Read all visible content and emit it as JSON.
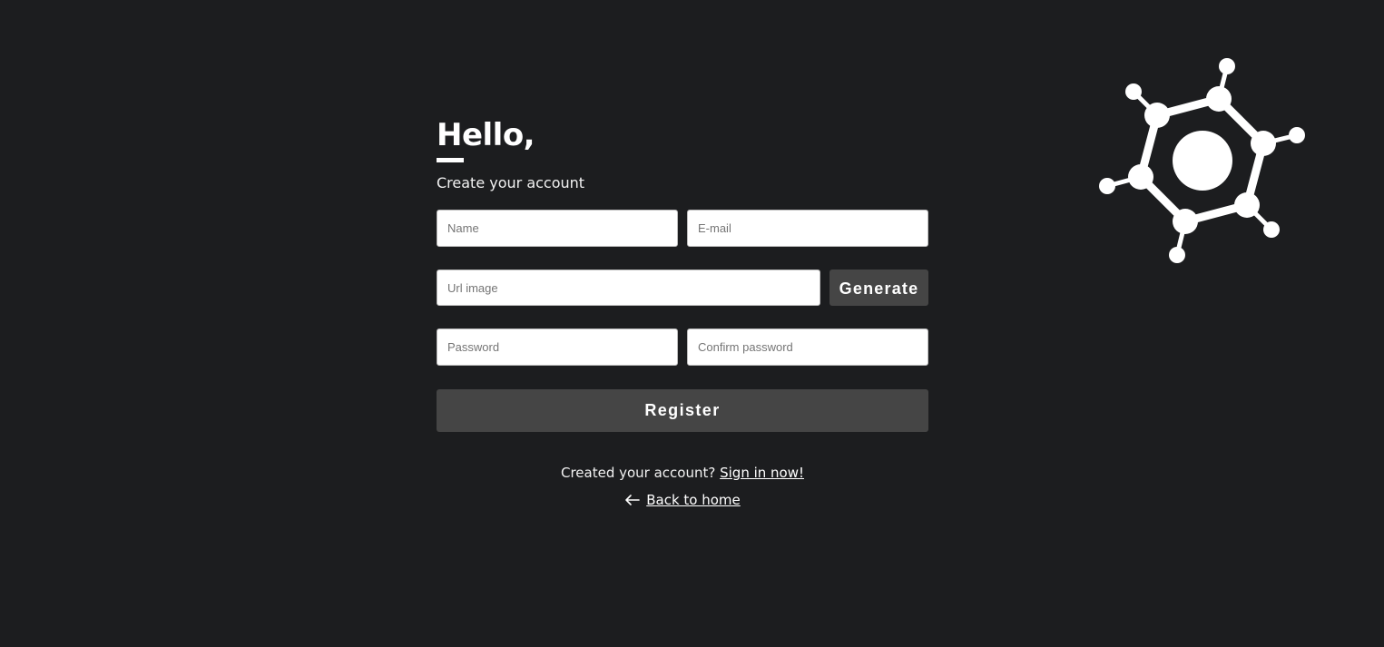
{
  "header": {
    "greeting": "Hello,",
    "subtitle": "Create your account"
  },
  "form": {
    "name_placeholder": "Name",
    "email_placeholder": "E-mail",
    "url_image_placeholder": "Url image",
    "generate_label": "Generate",
    "password_placeholder": "Password",
    "confirm_password_placeholder": "Confirm password",
    "register_label": "Register"
  },
  "footer": {
    "signin_prompt": "Created your account? ",
    "signin_link": "Sign in now!",
    "back_link": "Back to home"
  },
  "icons": {
    "logo": "molecule-icon",
    "back": "arrow-left-icon"
  },
  "colors": {
    "background": "#1c1d1f",
    "button": "#454545",
    "text": "#ffffff"
  }
}
